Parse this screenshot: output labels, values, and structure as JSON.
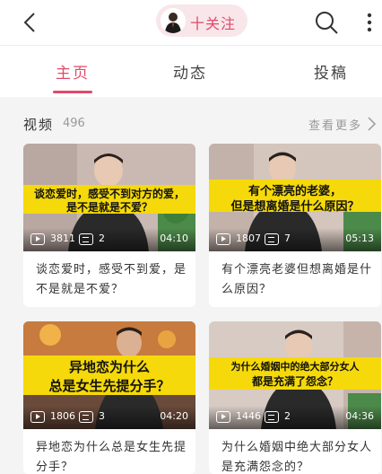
{
  "header": {
    "follow_label": "十关注",
    "icons": [
      "back-arrow-icon",
      "search-icon",
      "more-vertical-icon"
    ]
  },
  "tabs": [
    {
      "label": "主页",
      "active": true
    },
    {
      "label": "动态",
      "active": false
    },
    {
      "label": "投稿",
      "active": false
    }
  ],
  "section": {
    "title": "视频",
    "count": "496",
    "view_more": "查看更多"
  },
  "videos": [
    {
      "caption_line1": "谈恋爱时，感受不到对方的爱，",
      "caption_line2": "是不是就是不爱？",
      "plays": "3811",
      "comments": "2",
      "duration": "04:10",
      "title": "谈恋爱时，感受不到爱，是不是就是不爱？"
    },
    {
      "caption_line1": "有个漂亮的老婆，",
      "caption_line2": "但是想离婚是什么原因？",
      "plays": "1807",
      "comments": "7",
      "duration": "05:13",
      "title": "有个漂亮老婆但想离婚是什么原因？"
    },
    {
      "caption_line1": "异地恋为什么",
      "caption_line2": "总是女生先提分手？",
      "plays": "1806",
      "comments": "3",
      "duration": "04:20",
      "title": "异地恋为什么总是女生先提分手？"
    },
    {
      "caption_line1": "为什么婚姻中的绝大部分女人",
      "caption_line2": "都是充满了怨念？",
      "plays": "1446",
      "comments": "2",
      "duration": "04:36",
      "title": "为什么婚姻中绝大部分女人是充满怨念的？"
    }
  ],
  "colors": {
    "accent": "#e24a6a",
    "caption_band": "#f5d90a"
  }
}
